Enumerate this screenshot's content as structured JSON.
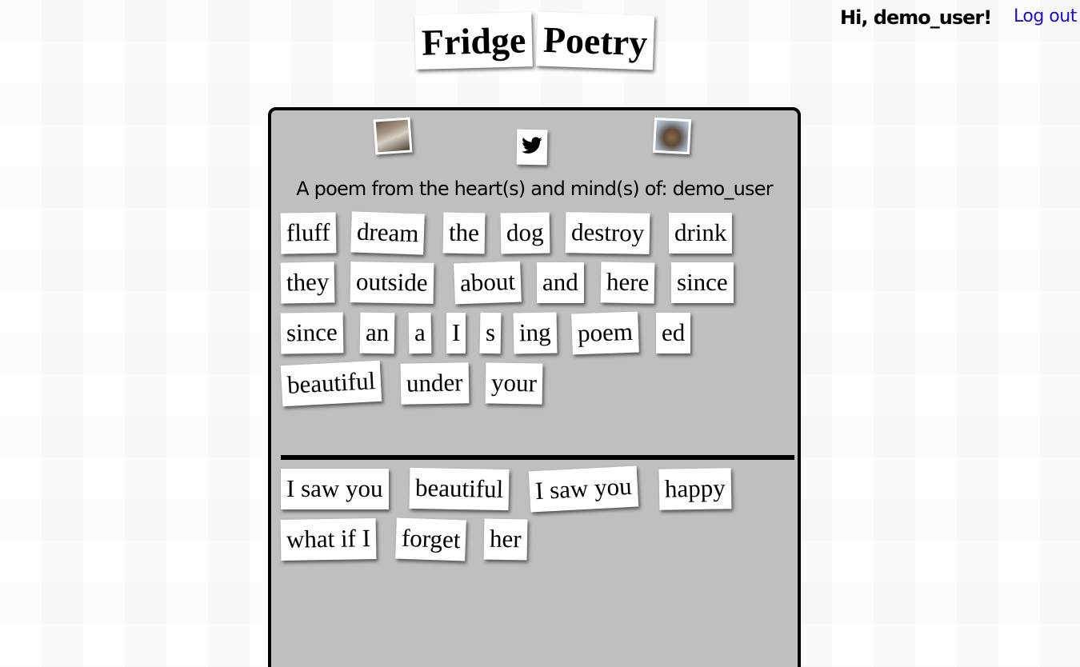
{
  "header": {
    "greeting": "Hi, demo_user!",
    "logout_label": "Log out"
  },
  "title": {
    "words": [
      "Fridge",
      "Poetry"
    ]
  },
  "board": {
    "icons": [
      "photo-avatar-icon",
      "twitter-icon",
      "dog-avatar-icon"
    ],
    "credit": "A poem from the heart(s) and mind(s) of: demo_user",
    "word_bank": [
      "fluff",
      "dream",
      "the",
      "dog",
      "destroy",
      "drink",
      "they",
      "outside",
      "about",
      "and",
      "here",
      "since",
      "since",
      "an",
      "a",
      "I",
      "s",
      "ing",
      "poem",
      "ed",
      "beautiful",
      "under",
      "your"
    ],
    "poem": [
      "I saw you",
      "beautiful",
      "I saw you",
      "happy",
      "what if I",
      "forget",
      "her"
    ]
  }
}
